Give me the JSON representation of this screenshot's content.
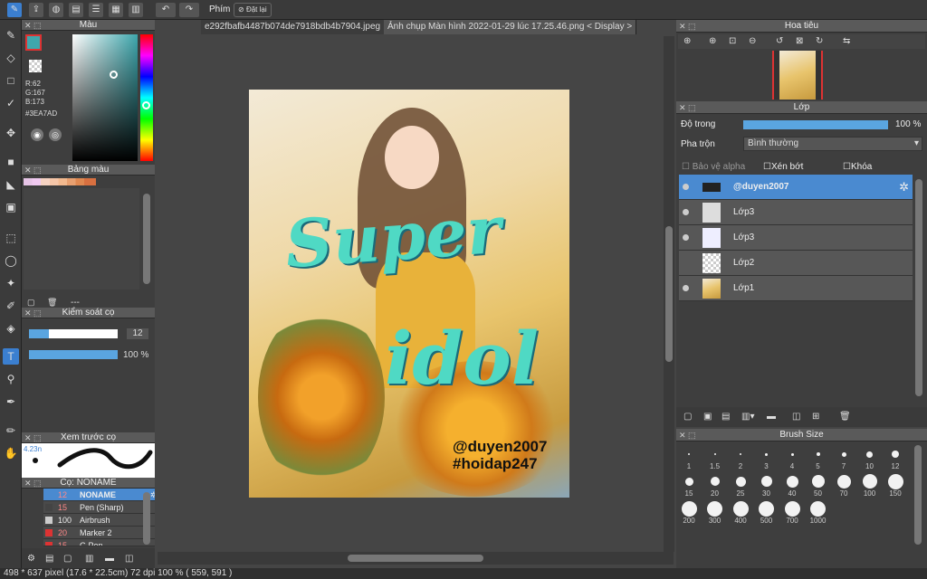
{
  "toolbar": {
    "shortcut_label": "Phím",
    "reset_label": "Đặt lại"
  },
  "tabs": [
    "e292fbafb4487b074de7918bdb4b7904.jpeg",
    "Ảnh chụp Màn hình 2022-01-29 lúc 17.25.46.png < Display >"
  ],
  "color_panel": {
    "title": "Màu",
    "r": "R:62",
    "g": "G:167",
    "b": "B:173",
    "hex": "#3EA7AD",
    "accent": "#3EA7AD"
  },
  "palette_panel": {
    "title": "Bảng màu",
    "dashes": "---"
  },
  "brush_control": {
    "title": "Kiểm soát cọ",
    "size_value": "12",
    "opacity_value": "100 %"
  },
  "brush_preview": {
    "title": "Xem trước cọ",
    "size_text": "4.23n"
  },
  "brush_list": {
    "title": "Cọ: NONAME",
    "items": [
      {
        "size": "12",
        "name": "NONAME"
      },
      {
        "size": "15",
        "name": "Pen (Sharp)"
      },
      {
        "size": "100",
        "name": "Airbrush"
      },
      {
        "size": "20",
        "name": "Marker 2"
      },
      {
        "size": "15",
        "name": "G Pen"
      }
    ]
  },
  "navigator": {
    "title": "Hoa tiêu"
  },
  "layers": {
    "title": "Lớp",
    "opacity_label": "Độ trong",
    "opacity_value": "100 %",
    "blend_label": "Pha trộn",
    "blend_value": "Bình thường",
    "protect_alpha": "Bảo vệ alpha",
    "clipping": "Xén bớt",
    "lock": "Khóa",
    "items": [
      "@duyen2007",
      "Lớp3",
      "Lớp3",
      "Lớp2",
      "Lớp1"
    ]
  },
  "brush_size": {
    "title": "Brush Size",
    "sizes": [
      "1",
      "1.5",
      "2",
      "3",
      "4",
      "5",
      "7",
      "10",
      "12",
      "15",
      "20",
      "25",
      "30",
      "40",
      "50",
      "70",
      "100",
      "150",
      "200",
      "300",
      "400",
      "500",
      "700",
      "1000"
    ]
  },
  "canvas": {
    "text1": "Super",
    "text2": "idol",
    "tag1": "@duyen2007",
    "tag2": "#hoidap247"
  },
  "status": "498 * 637 pixel  (17.6 * 22.5cm)  72 dpi  100 %  ( 559, 591 )"
}
